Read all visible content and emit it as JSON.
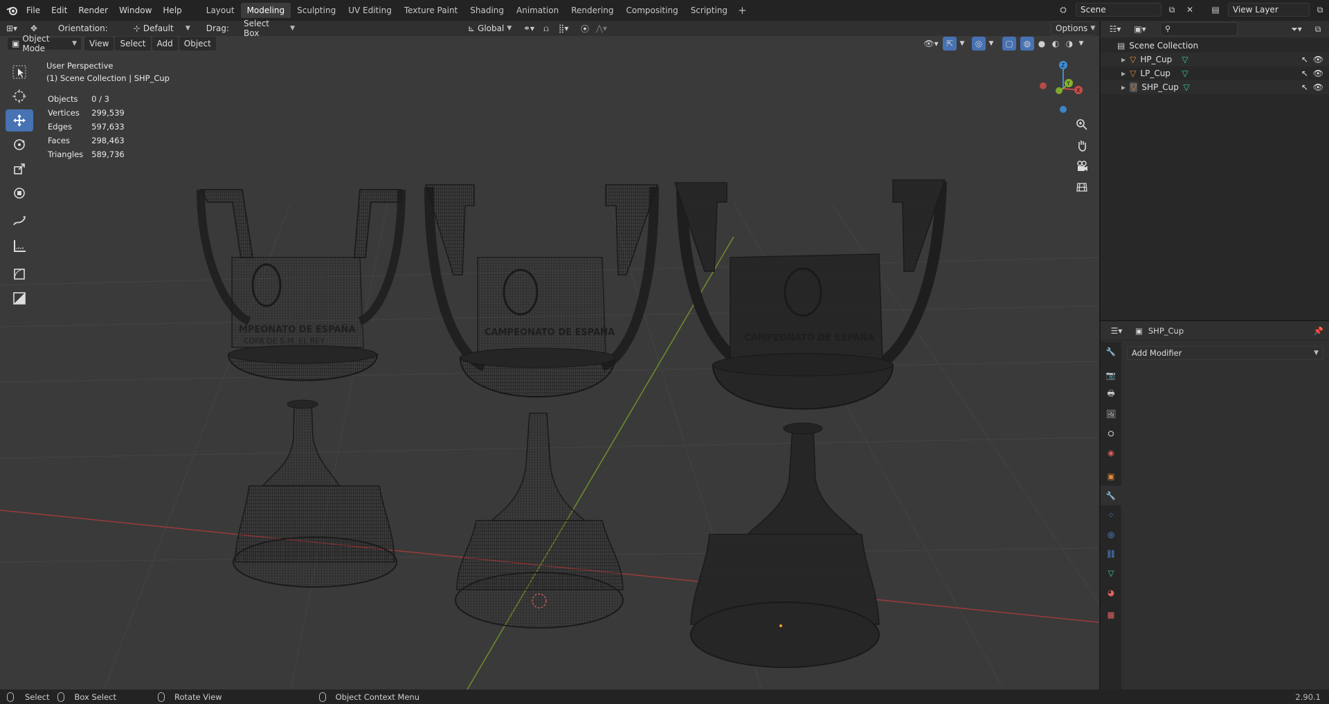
{
  "topbar": {
    "menus": [
      "File",
      "Edit",
      "Render",
      "Window",
      "Help"
    ],
    "workspaces": [
      "Layout",
      "Modeling",
      "Sculpting",
      "UV Editing",
      "Texture Paint",
      "Shading",
      "Animation",
      "Rendering",
      "Compositing",
      "Scripting"
    ],
    "active_workspace": "Modeling",
    "add_workspace": "+",
    "scene_name": "Scene",
    "view_layer": "View Layer"
  },
  "tool_header": {
    "orientation_label": "Orientation:",
    "orientation_value": "Default",
    "drag_label": "Drag:",
    "drag_value": "Select Box",
    "transform_orientation": "Global",
    "options_label": "Options"
  },
  "viewport_header": {
    "mode": "Object Mode",
    "menus": [
      "View",
      "Select",
      "Add",
      "Object"
    ]
  },
  "viewport": {
    "perspective": "User Perspective",
    "collection_path": "(1) Scene Collection | SHP_Cup",
    "stats": [
      {
        "label": "Objects",
        "value": "0 / 3"
      },
      {
        "label": "Vertices",
        "value": "299,539"
      },
      {
        "label": "Edges",
        "value": "597,633"
      },
      {
        "label": "Faces",
        "value": "298,463"
      },
      {
        "label": "Triangles",
        "value": "589,736"
      }
    ],
    "cup_text_left": "MPEONATO DE ESPAÑA",
    "cup_text_left2": "COPA DE S.M. EL REY",
    "cup_text_mid": "CAMPEONATO DE ESPAÑA",
    "cup_text_right": "CAMPEONATO DE ESPAÑA",
    "gizmo": {
      "z": "Z",
      "y": "Y",
      "x": "X"
    }
  },
  "outliner": {
    "search_placeholder": "",
    "root": "Scene Collection",
    "items": [
      {
        "name": "HP_Cup"
      },
      {
        "name": "LP_Cup"
      },
      {
        "name": "SHP_Cup"
      }
    ]
  },
  "properties": {
    "object_name": "SHP_Cup",
    "add_modifier": "Add Modifier"
  },
  "statusbar": {
    "items": [
      "Select",
      "Box Select",
      "Rotate View",
      "Object Context Menu"
    ],
    "version": "2.90.1"
  },
  "colors": {
    "accent": "#4772b3",
    "x_axis": "#c64b4b",
    "y_axis": "#86b32d",
    "z_axis": "#3f8ed6",
    "mesh_icon": "#e08a3a",
    "data_icon": "#3ecf8e"
  }
}
